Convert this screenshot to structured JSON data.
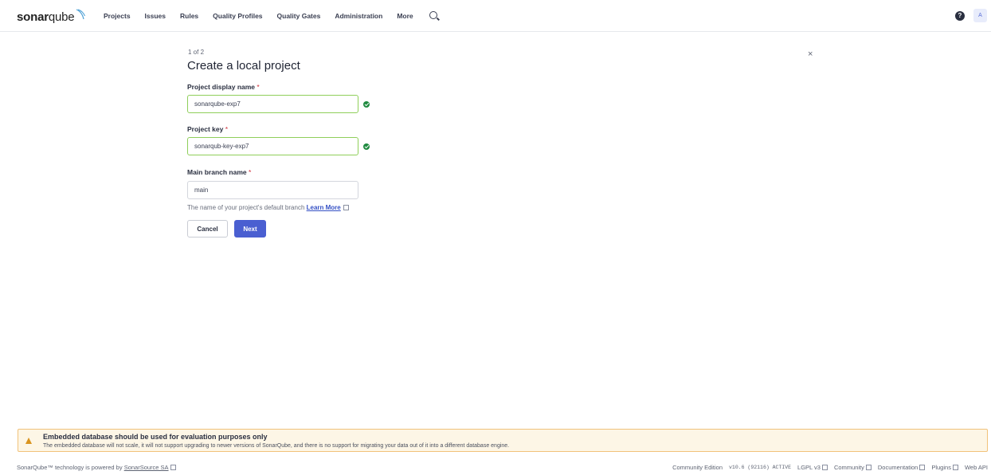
{
  "app": {
    "logo_bold": "sonar",
    "logo_light": "qube"
  },
  "nav": {
    "items": [
      "Projects",
      "Issues",
      "Rules",
      "Quality Profiles",
      "Quality Gates",
      "Administration",
      "More"
    ],
    "search_icon": "search-icon",
    "help_icon": "?",
    "avatar_initial": "A"
  },
  "form": {
    "step": "1 of 2",
    "title": "Create a local project",
    "display_name_label": "Project display name",
    "display_name_value": "sonarqube-exp7",
    "key_label": "Project key",
    "key_value": "sonarqub-key-exp7",
    "branch_label": "Main branch name",
    "branch_value": "main",
    "required_mark": "*",
    "helper_text": "The name of your project's default branch",
    "helper_link": "Learn More",
    "cancel_label": "Cancel",
    "next_label": "Next",
    "close_glyph": "×"
  },
  "banner": {
    "title": "Embedded database should be used for evaluation purposes only",
    "text": "The embedded database will not scale, it will not support upgrading to newer versions of SonarQube, and there is no support for migrating your data out of it into a different database engine."
  },
  "footer": {
    "powered_text": "SonarQube™ technology is powered by",
    "powered_link": "SonarSource SA",
    "edition": "Community Edition",
    "version": "v10.6 (92116) ACTIVE",
    "license": "LGPL v3",
    "community": "Community",
    "documentation": "Documentation",
    "plugins": "Plugins",
    "web_api": "Web API"
  },
  "colors": {
    "primary": "#4a5fd1",
    "valid_border": "#8fcf5a",
    "valid_icon": "#1f8a3f",
    "warning_bg": "#fdf6e6",
    "warning_border": "#f1c27a"
  }
}
